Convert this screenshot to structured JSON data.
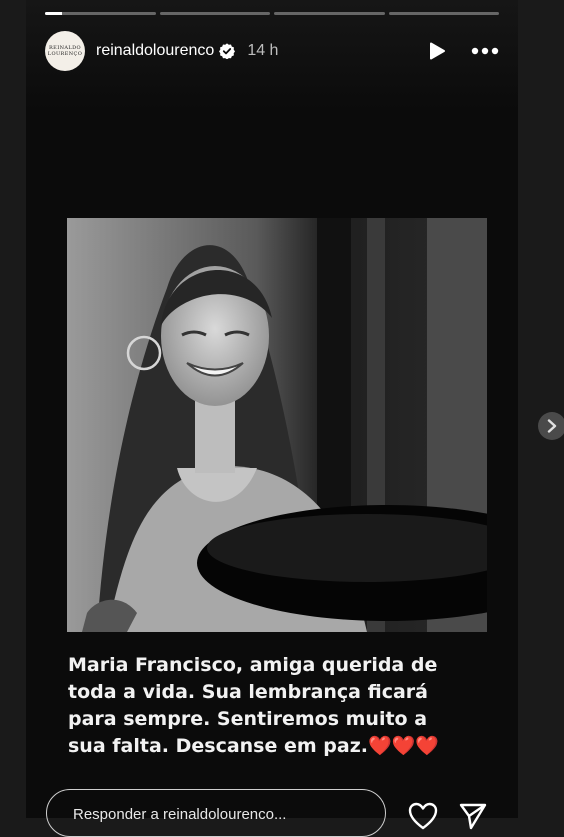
{
  "story": {
    "progress": {
      "segments": 4,
      "current_index": 0,
      "current_fraction": 0.15
    },
    "user": {
      "username": "reinaldolourenco",
      "avatar_text_line1": "REINALDO",
      "avatar_text_line2": "LOURENÇO",
      "verified_icon": "verified-badge-icon"
    },
    "timestamp": "14 h",
    "caption": "Maria Francisco,  amiga querida de\ntoda a vida. Sua lembrança ficará\npara sempre. Sentiremos muito a\nsua falta. Descanse em paz.❤️❤️❤️",
    "reply": {
      "placeholder": "Responder a reinaldolourenco..."
    }
  },
  "colors": {
    "background": "#1a1a1a",
    "story_bg": "#0b0b0b",
    "verified": "#ffffff"
  }
}
